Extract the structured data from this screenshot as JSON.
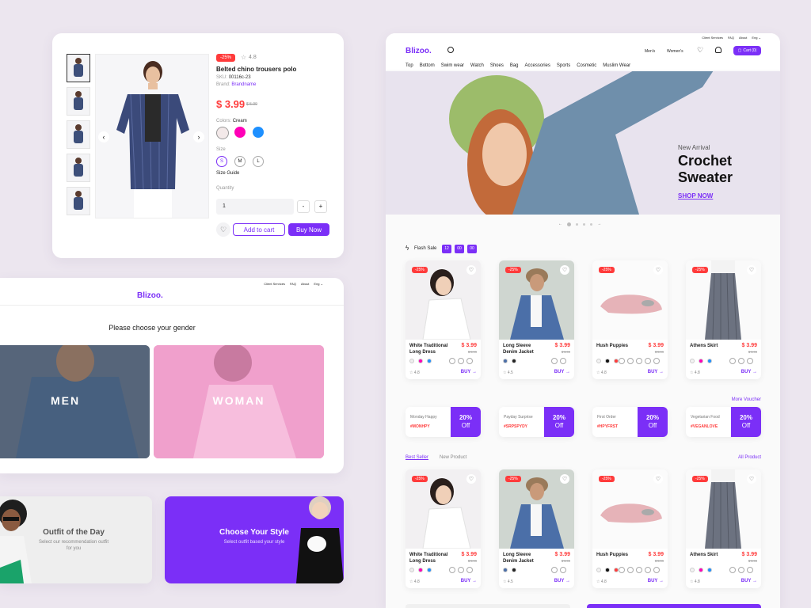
{
  "product_detail": {
    "discount": "-25%",
    "rating": "4.8",
    "title": "Belted chino trousers polo",
    "sku_label": "SKU:",
    "sku": "00116c-23",
    "brand_label": "Brand:",
    "brand": "Brandname",
    "price": "$ 3.99",
    "old_price": "$ 5.99",
    "colors_label": "Colors:",
    "color_selected": "Cream",
    "colors": [
      "#f3e9e9",
      "#ff00b7",
      "#1e90ff"
    ],
    "size_label": "Size",
    "sizes": [
      "S",
      "M",
      "L"
    ],
    "size_guide": "Size Guide",
    "quantity_label": "Quantity",
    "quantity": "1",
    "minus": "-",
    "plus": "+",
    "add_to_cart": "Add to cart",
    "buy_now": "Buy Now"
  },
  "gender": {
    "top_links": [
      "Client Services",
      "FAQ",
      "About",
      "Eng ⌄"
    ],
    "logo": "Blizoo.",
    "prompt": "Please choose your gender",
    "men": "MEN",
    "woman": "WOMAN"
  },
  "banners": {
    "outfit_title": "Outfit of the Day",
    "outfit_sub": "Select our recommendation outfit for you",
    "style_title": "Choose Your Style",
    "style_sub": "Select outfit based your style"
  },
  "shop": {
    "top_links": [
      "Client Services",
      "FAQ",
      "About",
      "Eng ⌄"
    ],
    "logo": "Blizoo.",
    "mens": "Men's",
    "womens": "Women's",
    "cart": "Cart (0)",
    "categories": [
      "Top",
      "Bottom",
      "Swim wear",
      "Watch",
      "Shoes",
      "Bag",
      "Accessories",
      "Sports",
      "Cosmetic",
      "Muslim Wear"
    ],
    "hero": {
      "eyebrow": "New Arrival",
      "title_1": "Crochet",
      "title_2": "Sweater",
      "cta": "SHOP NOW"
    },
    "flash_sale": "Flash Sale",
    "timer": [
      "12",
      "00",
      "00"
    ],
    "more_voucher": "More Voucher",
    "tabs": [
      "Best Seller",
      "New Product"
    ],
    "all_product": "All Product",
    "buy": "BUY",
    "products": [
      {
        "name": "White Traditional Long Dress",
        "price": "$ 3.99",
        "old": "$ 5.99",
        "rating": "4.8",
        "badge": "-25%"
      },
      {
        "name": "Long Sleeve Denim Jacket",
        "price": "$ 3.99",
        "old": "$ 5.99",
        "rating": "4.5",
        "badge": "-25%"
      },
      {
        "name": "Hush Puppies",
        "price": "$ 3.99",
        "old": "$ 5.99",
        "rating": "4.8",
        "badge": "-25%"
      },
      {
        "name": "Athens Skirt",
        "price": "$ 3.99",
        "old": "$ 5.99",
        "rating": "4.8",
        "badge": "-25%"
      }
    ],
    "vouchers": [
      {
        "label": "Monday Happy",
        "code": "#MONHPY",
        "pct": "20%",
        "off": "Off"
      },
      {
        "label": "Payday Surprise",
        "code": "#SRPSPYDY",
        "pct": "20%",
        "off": "Off"
      },
      {
        "label": "First Order",
        "code": "#HPYFRST",
        "pct": "20%",
        "off": "Off"
      },
      {
        "label": "Vegetarian Food",
        "code": "#VEGANLOVE",
        "pct": "20%",
        "off": "Off"
      }
    ]
  }
}
